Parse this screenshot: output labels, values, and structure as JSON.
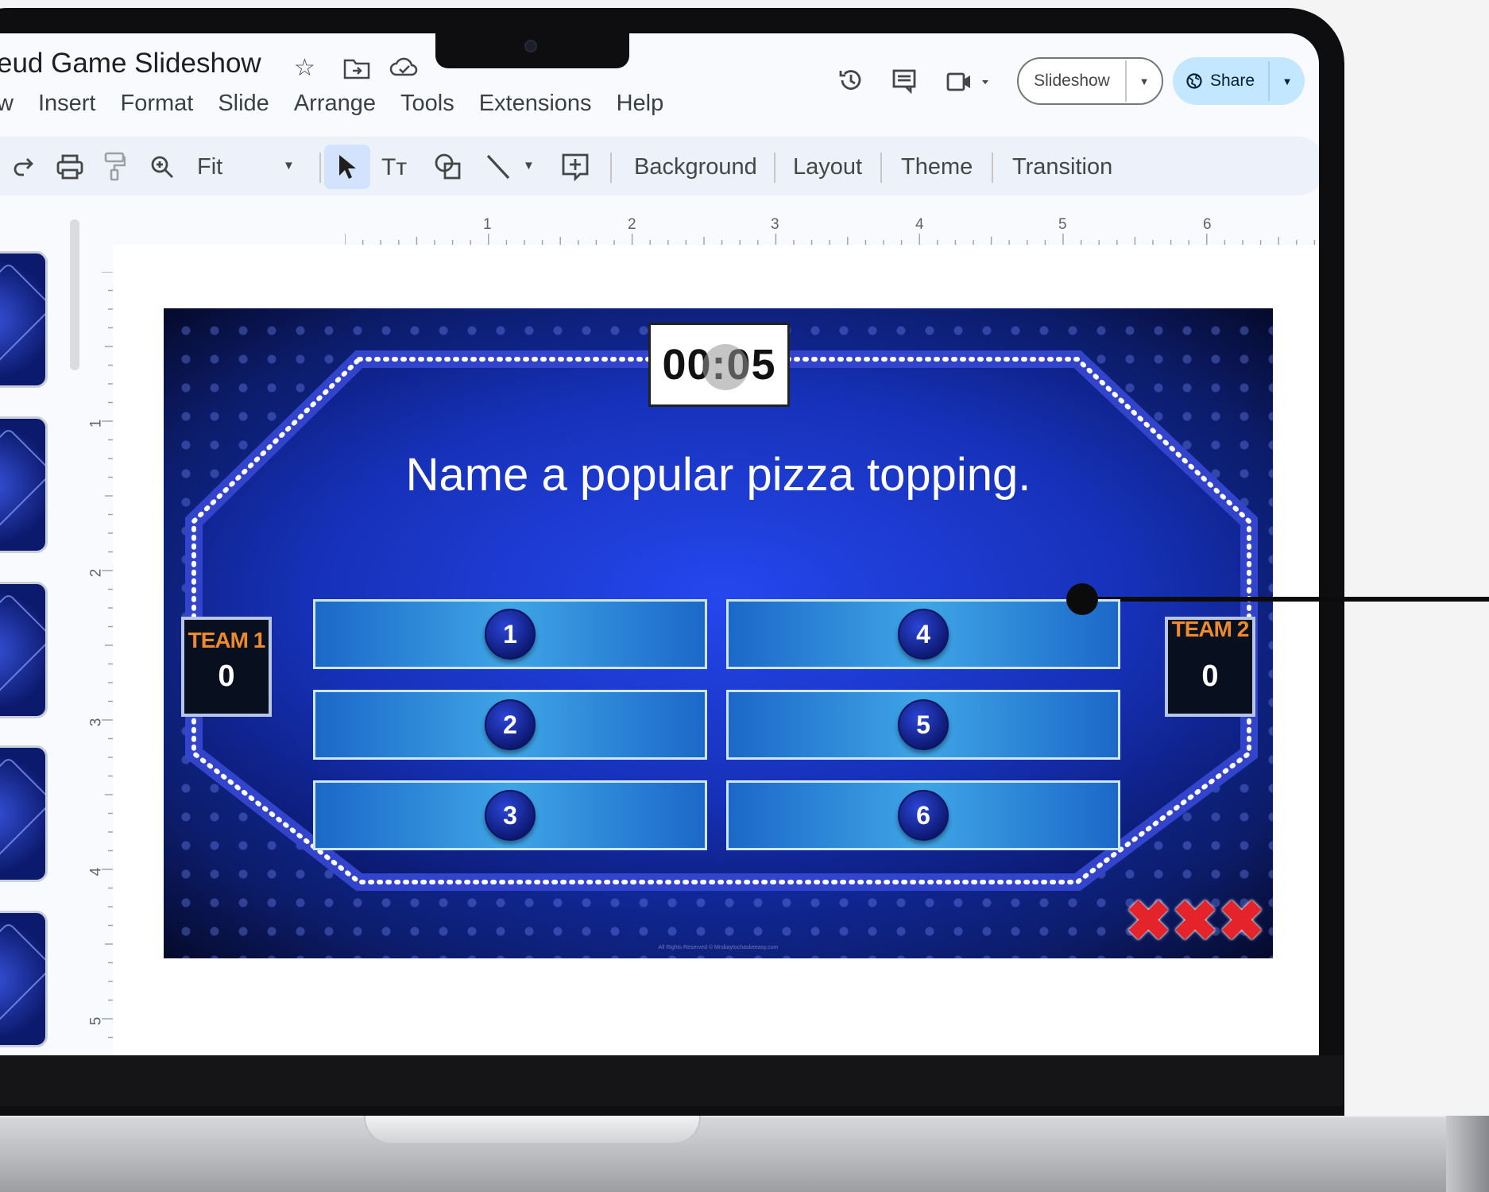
{
  "document": {
    "title": "eud Game Slideshow",
    "menu": [
      "w",
      "Insert",
      "Format",
      "Slide",
      "Arrange",
      "Tools",
      "Extensions",
      "Help"
    ]
  },
  "header": {
    "slideshow_label": "Slideshow",
    "share_label": "Share"
  },
  "toolbar": {
    "zoom_label": "Fit",
    "background_label": "Background",
    "layout_label": "Layout",
    "theme_label": "Theme",
    "transition_label": "Transition"
  },
  "ruler": {
    "horizontal": [
      "1",
      "2",
      "3",
      "4",
      "5",
      "6"
    ],
    "vertical": [
      "1",
      "2",
      "3",
      "4",
      "5"
    ]
  },
  "slide": {
    "timer": "00:05",
    "question": "Name a popular pizza topping.",
    "answers": [
      "1",
      "2",
      "3",
      "4",
      "5",
      "6"
    ],
    "team1": {
      "name": "TEAM 1",
      "score": "0"
    },
    "team2": {
      "name": "TEAM 2",
      "score": "0"
    },
    "strikes": [
      "✖",
      "✖",
      "✖"
    ],
    "copyright": "All Rights Reserved © Mrsbaytochaskeeasy.com"
  },
  "colors": {
    "slide_bg": "#1330b8",
    "accent_blue": "#c2e7ff",
    "toolbar_bg": "#edf2fa",
    "team_name": "#ee8a2c",
    "strike": "#e5232b"
  }
}
